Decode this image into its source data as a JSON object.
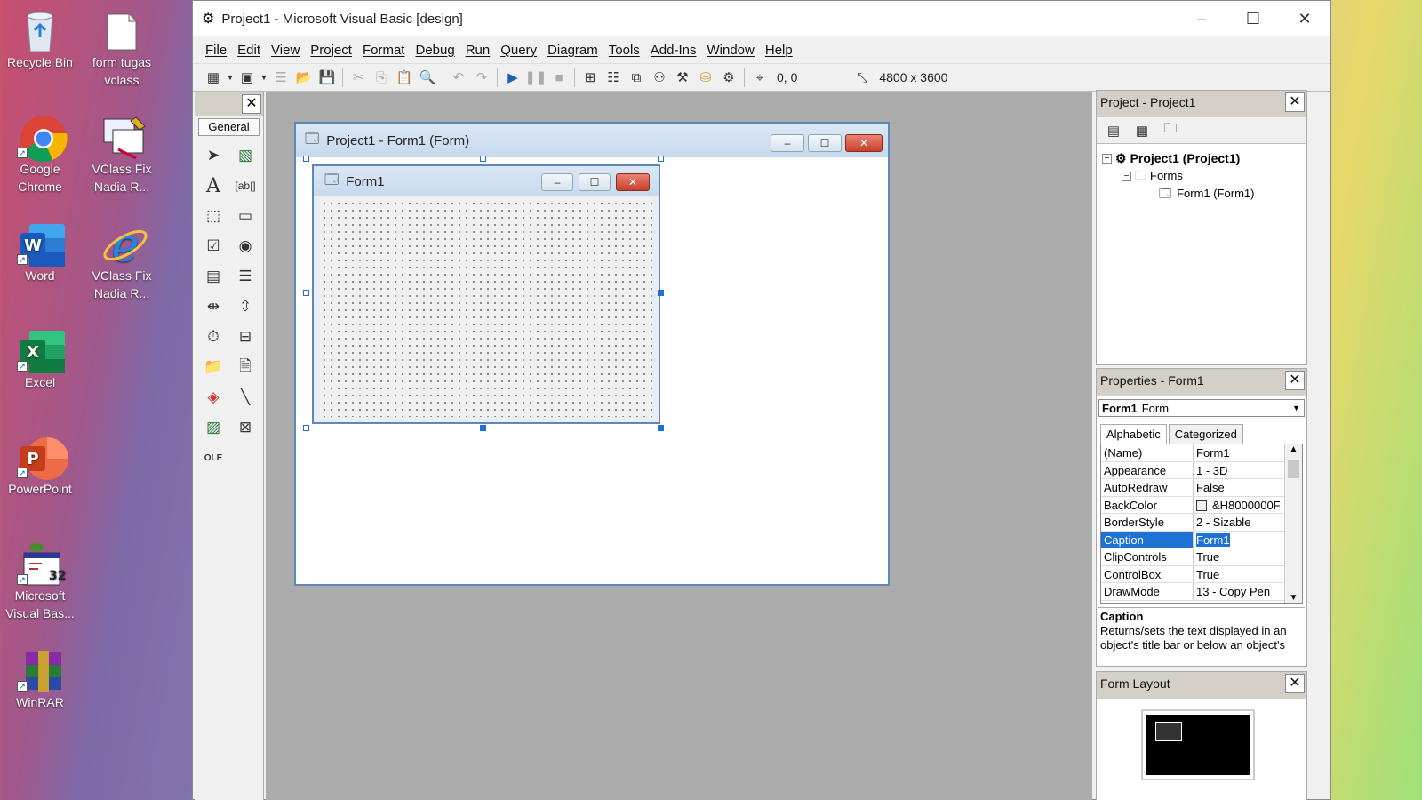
{
  "desktop": {
    "icons": [
      {
        "label": "Recycle Bin",
        "icon": "recycle-bin-icon"
      },
      {
        "label": "form tugas vclass",
        "icon": "file-icon"
      },
      {
        "label": "Google Chrome",
        "icon": "chrome-icon"
      },
      {
        "label": "VClass Fix Nadia R...",
        "icon": "vclass-icon"
      },
      {
        "label": "Word",
        "icon": "word-icon"
      },
      {
        "label": "VClass Fix Nadia R...",
        "icon": "ie-icon"
      },
      {
        "label": "Excel",
        "icon": "excel-icon"
      },
      {
        "label": "PowerPoint",
        "icon": "powerpoint-icon"
      },
      {
        "label": "Microsoft Visual Bas...",
        "icon": "vb6-icon"
      },
      {
        "label": "WinRAR",
        "icon": "winrar-icon"
      }
    ]
  },
  "window": {
    "title": "Project1 - Microsoft Visual Basic [design]",
    "controls": [
      "–",
      "☐",
      "✕"
    ]
  },
  "menu": [
    "File",
    "Edit",
    "View",
    "Project",
    "Format",
    "Debug",
    "Run",
    "Query",
    "Diagram",
    "Tools",
    "Add-Ins",
    "Window",
    "Help"
  ],
  "toolbar": {
    "position": "0, 0",
    "size": "4800 x 3600"
  },
  "toolbox": {
    "tab": "General",
    "close": "✕"
  },
  "designer": {
    "title": "Project1 - Form1 (Form)",
    "form_caption": "Form1"
  },
  "project_panel": {
    "title": "Project - Project1",
    "root": "Project1 (Project1)",
    "folder": "Forms",
    "item": "Form1 (Form1)"
  },
  "properties_panel": {
    "title": "Properties - Form1",
    "object_name": "Form1",
    "object_type": "Form",
    "tabs": [
      "Alphabetic",
      "Categorized"
    ],
    "rows": [
      {
        "name": "(Name)",
        "value": "Form1"
      },
      {
        "name": "Appearance",
        "value": "1 - 3D"
      },
      {
        "name": "AutoRedraw",
        "value": "False"
      },
      {
        "name": "BackColor",
        "value": "&H8000000F"
      },
      {
        "name": "BorderStyle",
        "value": "2 - Sizable"
      },
      {
        "name": "Caption",
        "value": "Form1"
      },
      {
        "name": "ClipControls",
        "value": "True"
      },
      {
        "name": "ControlBox",
        "value": "True"
      },
      {
        "name": "DrawMode",
        "value": "13 - Copy Pen"
      }
    ],
    "selected_row": 5,
    "desc_title": "Caption",
    "desc_text": "Returns/sets the text displayed in an object's title bar or below an object's"
  },
  "layout_panel": {
    "title": "Form Layout"
  }
}
